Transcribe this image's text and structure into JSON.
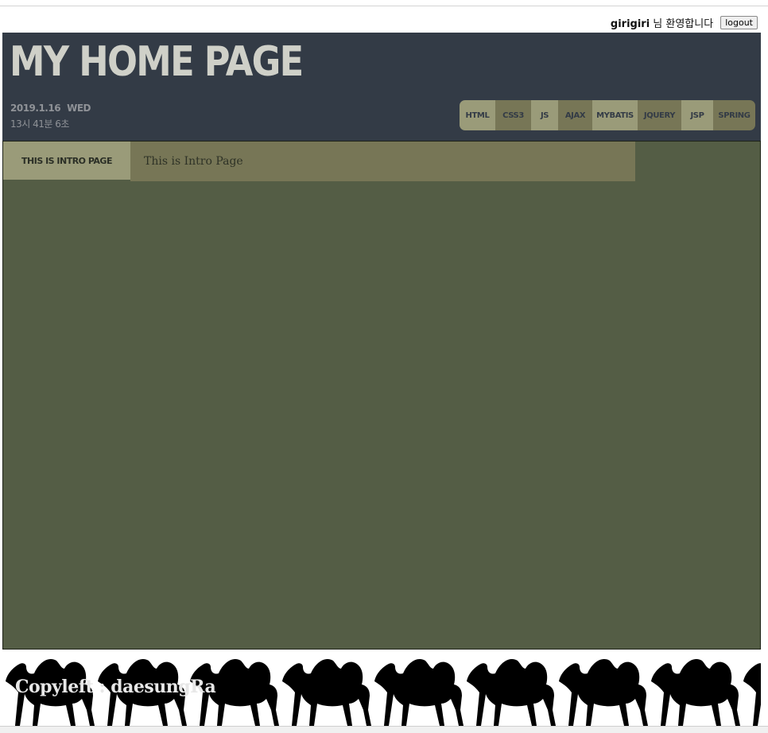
{
  "userbar": {
    "username": "girigiri",
    "welcome_suffix": "님 환영합니다",
    "logout_label": "logout"
  },
  "header": {
    "title": "MY HOME PAGE",
    "date": "2019.1.16",
    "weekday": "WED",
    "time": "13시 41분 6초"
  },
  "nav": {
    "items": [
      {
        "label": "HTML"
      },
      {
        "label": "CSS3"
      },
      {
        "label": "JS"
      },
      {
        "label": "AJAX"
      },
      {
        "label": "MYBATIS"
      },
      {
        "label": "JQUERY"
      },
      {
        "label": "JSP"
      },
      {
        "label": "SPRING"
      }
    ]
  },
  "main": {
    "intro_tab": "THIS IS INTRO PAGE",
    "intro_text": "This is Intro Page"
  },
  "footer": {
    "copyleft": "Copyleft : daesungRa",
    "pattern_icon": "camel-icon"
  },
  "colors": {
    "header_bg": "#333b46",
    "content_bg": "#545d45",
    "accent_light": "#9a9b79",
    "accent_dark": "#777656"
  }
}
